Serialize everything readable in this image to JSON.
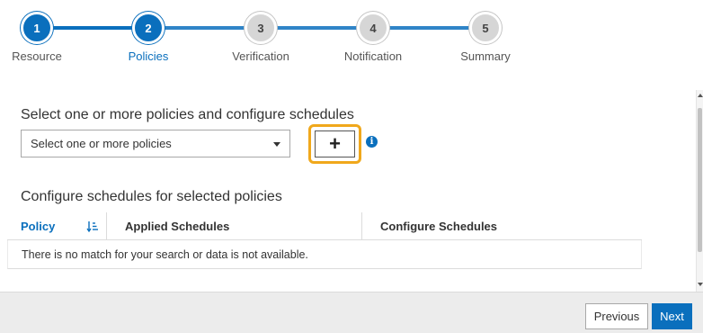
{
  "stepper": {
    "steps": [
      {
        "number": "1",
        "label": "Resource",
        "state": "completed"
      },
      {
        "number": "2",
        "label": "Policies",
        "state": "current"
      },
      {
        "number": "3",
        "label": "Verification",
        "state": "pending"
      },
      {
        "number": "4",
        "label": "Notification",
        "state": "pending"
      },
      {
        "number": "5",
        "label": "Summary",
        "state": "pending"
      }
    ]
  },
  "policies": {
    "section_title": "Select one or more policies and configure schedules",
    "select_value": "Select one or more policies",
    "add_label": "+",
    "info_label": "i"
  },
  "schedules": {
    "section_title": "Configure schedules for selected policies",
    "columns": {
      "policy": "Policy",
      "applied": "Applied Schedules",
      "configure": "Configure Schedules"
    },
    "empty_message": "There is no match for your search or data is not available."
  },
  "footer": {
    "previous_label": "Previous",
    "next_label": "Next"
  },
  "colors": {
    "accent": "#0a6fbd",
    "highlight": "#f0a81c",
    "pending": "#d6d6d6"
  }
}
